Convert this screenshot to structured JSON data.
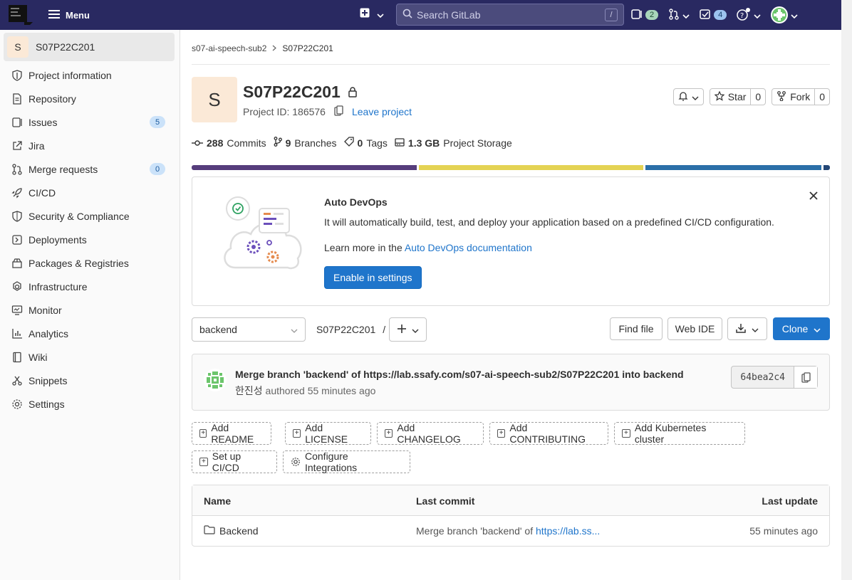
{
  "topbar": {
    "menu_label": "Menu",
    "search_placeholder": "Search GitLab",
    "search_shortcut": "/",
    "issues_count": "2",
    "todos_count": "4",
    "bg_color": "#292961"
  },
  "sidebar": {
    "project_initial": "S",
    "project_name": "S07P22C201",
    "items": [
      {
        "label": "Project information",
        "icon": "info-icon"
      },
      {
        "label": "Repository",
        "icon": "doc-icon"
      },
      {
        "label": "Issues",
        "icon": "issues-icon",
        "badge": "5"
      },
      {
        "label": "Jira",
        "icon": "external-link-icon"
      },
      {
        "label": "Merge requests",
        "icon": "merge-request-icon",
        "badge": "0"
      },
      {
        "label": "CI/CD",
        "icon": "rocket-icon"
      },
      {
        "label": "Security & Compliance",
        "icon": "shield-icon"
      },
      {
        "label": "Deployments",
        "icon": "deployments-icon"
      },
      {
        "label": "Packages & Registries",
        "icon": "package-icon"
      },
      {
        "label": "Infrastructure",
        "icon": "infrastructure-icon"
      },
      {
        "label": "Monitor",
        "icon": "monitor-icon"
      },
      {
        "label": "Analytics",
        "icon": "analytics-icon"
      },
      {
        "label": "Wiki",
        "icon": "book-icon"
      },
      {
        "label": "Snippets",
        "icon": "snippet-icon"
      },
      {
        "label": "Settings",
        "icon": "settings-icon"
      }
    ]
  },
  "breadcrumb": {
    "parent": "s07-ai-speech-sub2",
    "current": "S07P22C201"
  },
  "project": {
    "initial": "S",
    "name": "S07P22C201",
    "id_label": "Project ID: 186576",
    "leave_label": "Leave project",
    "star_label": "Star",
    "star_count": "0",
    "fork_label": "Fork",
    "fork_count": "0"
  },
  "stats": {
    "commits_num": "288",
    "commits_label": "Commits",
    "branches_num": "9",
    "branches_label": "Branches",
    "tags_num": "0",
    "tags_label": "Tags",
    "storage_num": "1.3 GB",
    "storage_label": "Project Storage"
  },
  "languages": [
    {
      "color": "#563d7c",
      "fraction": 0.356
    },
    {
      "color": "#e4d354",
      "fraction": 0.356
    },
    {
      "color": "#2b6fa8",
      "fraction": 0.278
    },
    {
      "color": "#244776",
      "fraction": 0.01
    }
  ],
  "devops": {
    "title": "Auto DevOps",
    "description": "It will automatically build, test, and deploy your application based on a predefined CI/CD configuration.",
    "learn_prefix": "Learn more in the",
    "learn_link": "Auto DevOps documentation",
    "button": "Enable in settings"
  },
  "repo": {
    "branch": "backend",
    "path": "S07P22C201",
    "path_sep": "/",
    "find_file": "Find file",
    "web_ide": "Web IDE",
    "clone": "Clone"
  },
  "commit": {
    "message": "Merge branch 'backend' of https://lab.ssafy.com/s07-ai-speech-sub2/S07P22C201 into backend",
    "author": "한진성",
    "meta": "authored 55 minutes ago",
    "sha": "64bea2c4"
  },
  "quick_actions": [
    {
      "label": "Add README"
    },
    {
      "label": "Add LICENSE"
    },
    {
      "label": "Add CHANGELOG"
    },
    {
      "label": "Add CONTRIBUTING"
    },
    {
      "label": "Add Kubernetes cluster"
    },
    {
      "label": "Set up CI/CD"
    },
    {
      "label": "Configure Integrations"
    }
  ],
  "tree": {
    "headers": {
      "name": "Name",
      "last_commit": "Last commit",
      "last_update": "Last update"
    },
    "rows": [
      {
        "name": "Backend",
        "commit_prefix": "Merge branch 'backend' of ",
        "commit_link": "https://lab.ss...",
        "updated": "55 minutes ago"
      }
    ]
  }
}
